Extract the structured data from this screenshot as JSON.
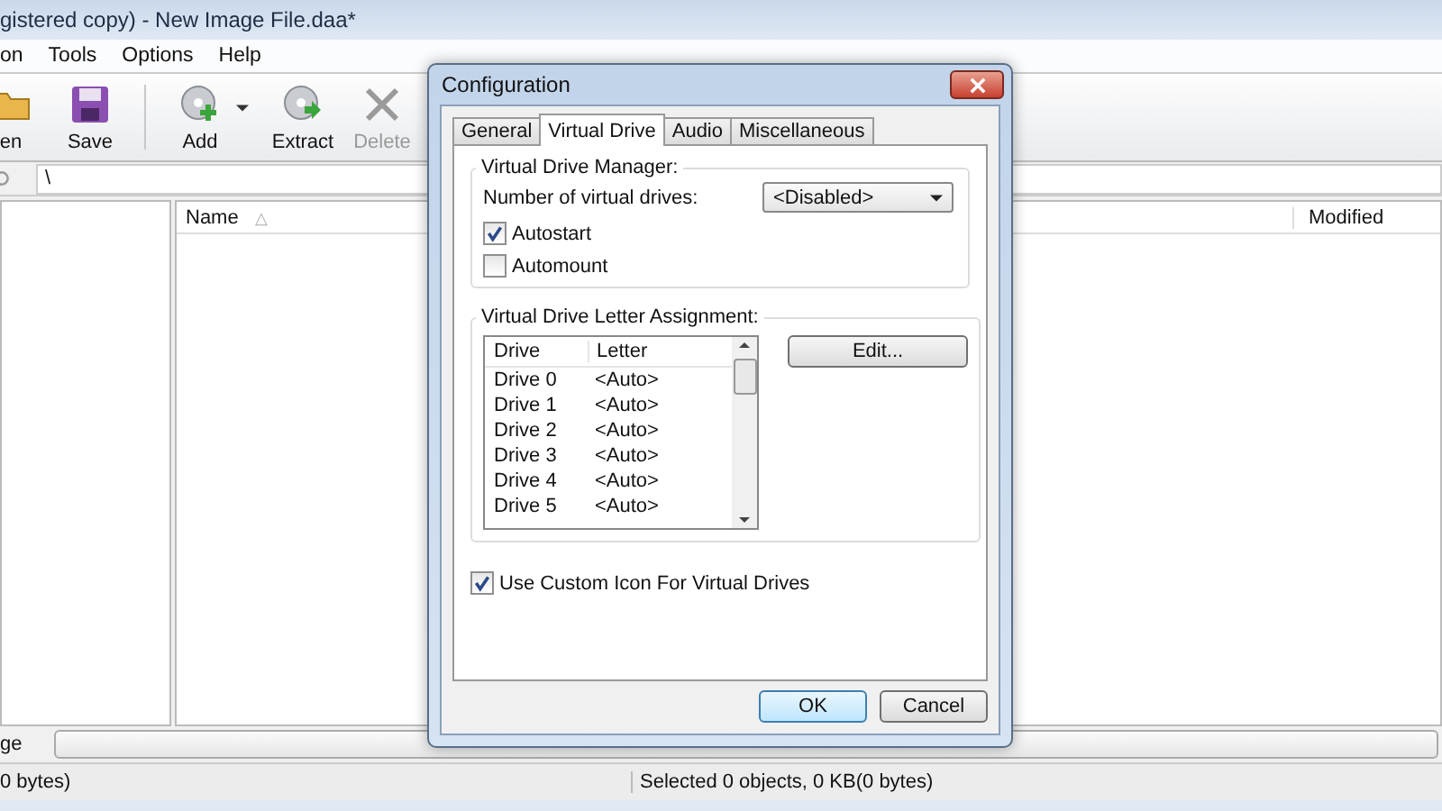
{
  "window": {
    "title": "gistered copy) - New Image File.daa*"
  },
  "menu": [
    "on",
    "Tools",
    "Options",
    "Help"
  ],
  "toolbar": [
    {
      "label": "en",
      "kind": "open",
      "disabled": false
    },
    {
      "label": "Save",
      "kind": "save",
      "disabled": false
    },
    {
      "label": "Add",
      "kind": "add",
      "disabled": false
    },
    {
      "label": "Extract",
      "kind": "extract",
      "disabled": false
    },
    {
      "label": "Delete",
      "kind": "delete",
      "disabled": true
    }
  ],
  "path": {
    "value": "\\"
  },
  "file_list": {
    "columns": [
      "Name",
      "Modified"
    ],
    "sort_indicator": "△"
  },
  "progress": {
    "label": "ge",
    "level": 0
  },
  "status_bar": [
    "0 bytes)",
    "Selected 0 objects, 0 KB(0 bytes)"
  ],
  "dialog": {
    "title": "Configuration",
    "tabs": [
      {
        "label": "General",
        "selected": false
      },
      {
        "label": "Virtual Drive",
        "selected": true
      },
      {
        "label": "Audio",
        "selected": false
      },
      {
        "label": "Miscellaneous",
        "selected": false
      }
    ],
    "manager": {
      "title": "Virtual Drive Manager:",
      "count_label": "Number of virtual drives:",
      "count_value": "<Disabled>",
      "options": [
        {
          "label": "Autostart",
          "checked": true
        },
        {
          "label": "Automount",
          "checked": false
        }
      ]
    },
    "letters": {
      "title": "Virtual Drive Letter Assignment:",
      "columns": [
        "Drive",
        "Letter"
      ],
      "rows": [
        [
          "Drive 0",
          "<Auto>"
        ],
        [
          "Drive 1",
          "<Auto>"
        ],
        [
          "Drive 2",
          "<Auto>"
        ],
        [
          "Drive 3",
          "<Auto>"
        ],
        [
          "Drive 4",
          "<Auto>"
        ],
        [
          "Drive 5",
          "<Auto>"
        ]
      ],
      "edit_button": "Edit..."
    },
    "custom_icon": {
      "label": "Use Custom Icon For Virtual Drives",
      "checked": true
    },
    "buttons": [
      {
        "label": "OK",
        "kind": "default"
      },
      {
        "label": "Cancel",
        "kind": "normal"
      }
    ]
  }
}
